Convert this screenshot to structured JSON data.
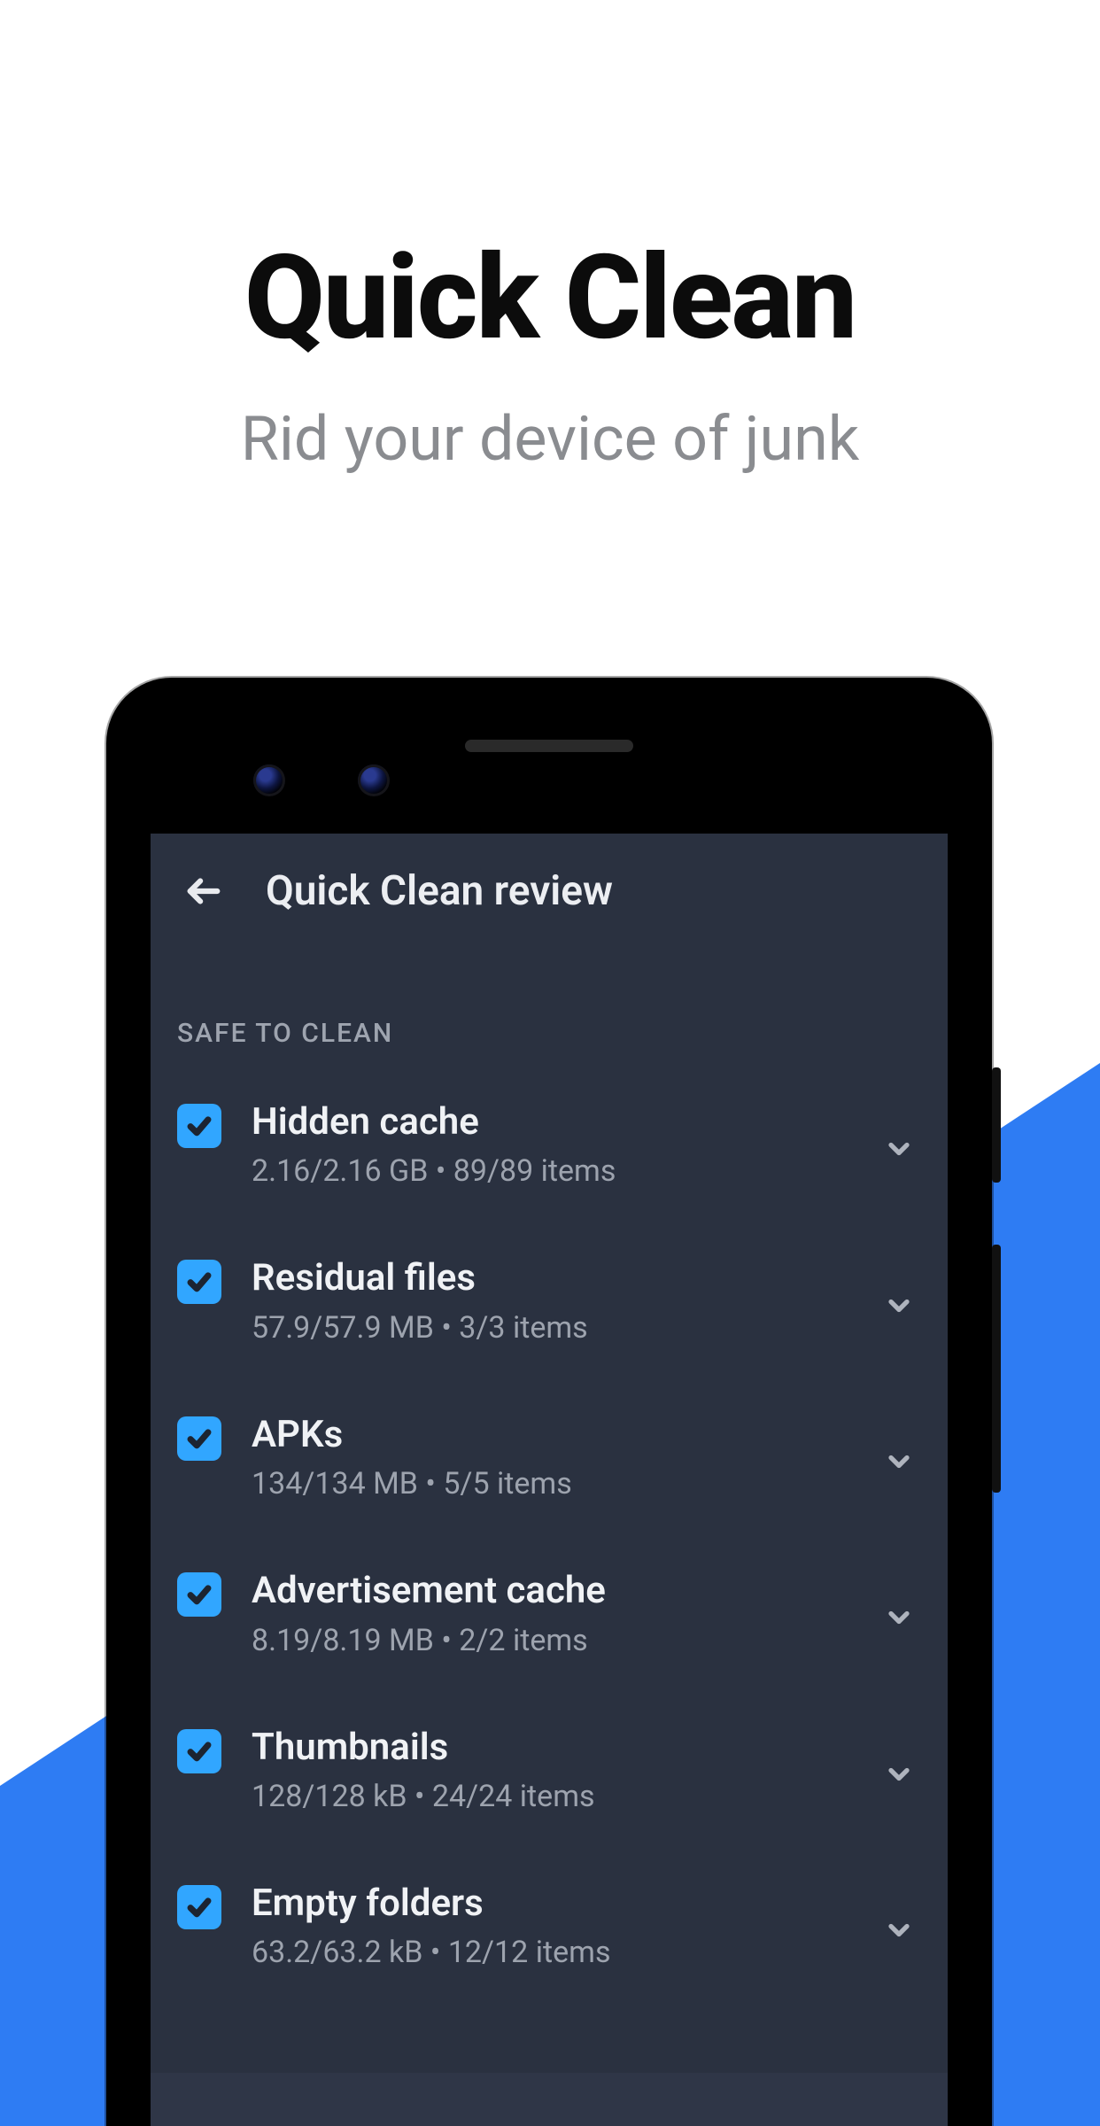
{
  "marketing": {
    "headline": "Quick Clean",
    "subhead": "Rid your device of junk"
  },
  "app": {
    "title": "Quick Clean review",
    "section_label": "SAFE TO CLEAN",
    "separator": " • "
  },
  "items": [
    {
      "title": "Hidden cache",
      "size": "2.16/2.16 GB",
      "count": "89/89 items",
      "checked": true
    },
    {
      "title": "Residual files",
      "size": "57.9/57.9 MB",
      "count": "3/3 items",
      "checked": true
    },
    {
      "title": "APKs",
      "size": "134/134 MB",
      "count": "5/5 items",
      "checked": true
    },
    {
      "title": "Advertisement cache",
      "size": "8.19/8.19 MB",
      "count": "2/2 items",
      "checked": true
    },
    {
      "title": "Thumbnails",
      "size": "128/128 kB",
      "count": "24/24 items",
      "checked": true
    },
    {
      "title": "Empty folders",
      "size": "63.2/63.2 kB",
      "count": "12/12 items",
      "checked": true
    }
  ],
  "colors": {
    "accent": "#31a6ff",
    "wedge": "#2e7cf3",
    "screen_bg": "#2a3140"
  }
}
